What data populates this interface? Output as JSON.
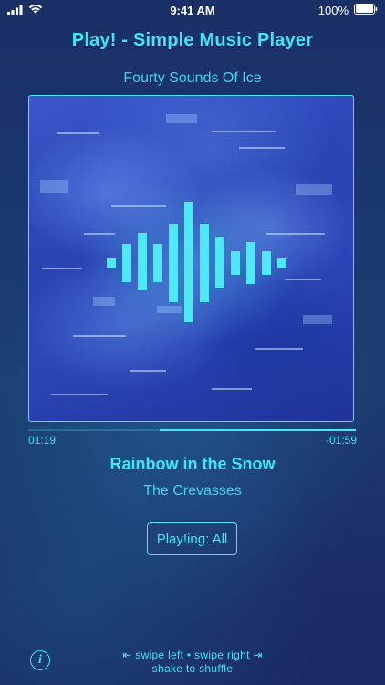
{
  "status_bar": {
    "time": "9:41 AM",
    "battery": "100%",
    "icons": [
      "signal-icon",
      "wifi-icon",
      "battery-icon"
    ]
  },
  "app": {
    "title": "Play! - Simple Music Player"
  },
  "album": {
    "name": "Fourty Sounds Of Ice",
    "artwork_icon": "waveform-icon"
  },
  "playback": {
    "elapsed": "01:19",
    "remaining": "-01:59",
    "progress_fraction": 0.4
  },
  "track": {
    "title": "Rainbow in the Snow",
    "artist": "The Crevasses"
  },
  "play_mode": {
    "label": "Play!ing: All"
  },
  "hints": {
    "swipe": "⇤ swipe left • swipe right ⇥",
    "shake": "shake to shuffle"
  },
  "colors": {
    "accent": "#40e6f2",
    "background": "#1a3368",
    "artwork": "#2a44b4"
  }
}
